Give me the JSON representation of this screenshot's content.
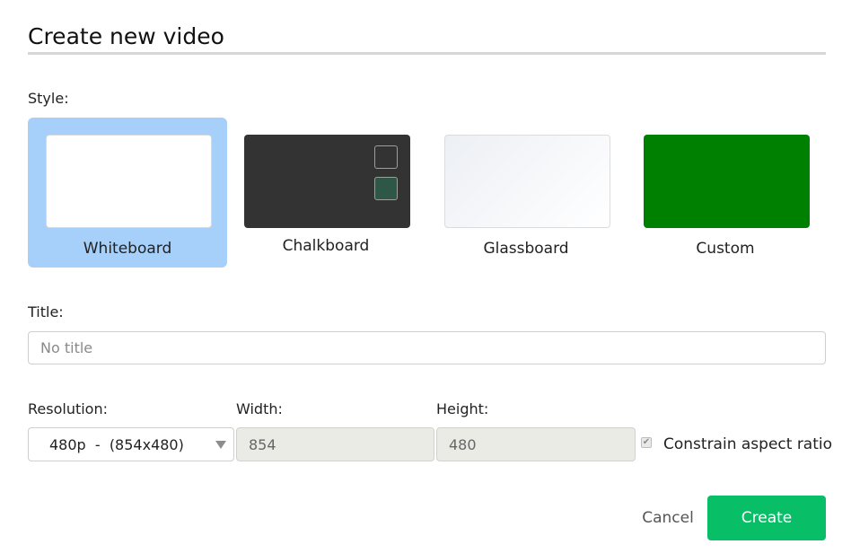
{
  "dialog": {
    "title": "Create new video"
  },
  "style": {
    "label": "Style:",
    "options": [
      {
        "label": "Whiteboard",
        "selected": true
      },
      {
        "label": "Chalkboard",
        "selected": false
      },
      {
        "label": "Glassboard",
        "selected": false
      },
      {
        "label": "Custom",
        "selected": false
      }
    ]
  },
  "title_field": {
    "label": "Title:",
    "value": "",
    "placeholder": "No title"
  },
  "resolution": {
    "label": "Resolution:",
    "selected": "480p  -  (854x480)"
  },
  "width": {
    "label": "Width:",
    "value": "854"
  },
  "height": {
    "label": "Height:",
    "value": "480"
  },
  "constrain": {
    "label": "Constrain aspect ratio",
    "checked": true
  },
  "actions": {
    "cancel_label": "Cancel",
    "create_label": "Create"
  },
  "colors": {
    "selected_card": "#a6cff9",
    "chalkboard": "#333333",
    "custom": "#008000",
    "create_button": "#08bf68"
  }
}
